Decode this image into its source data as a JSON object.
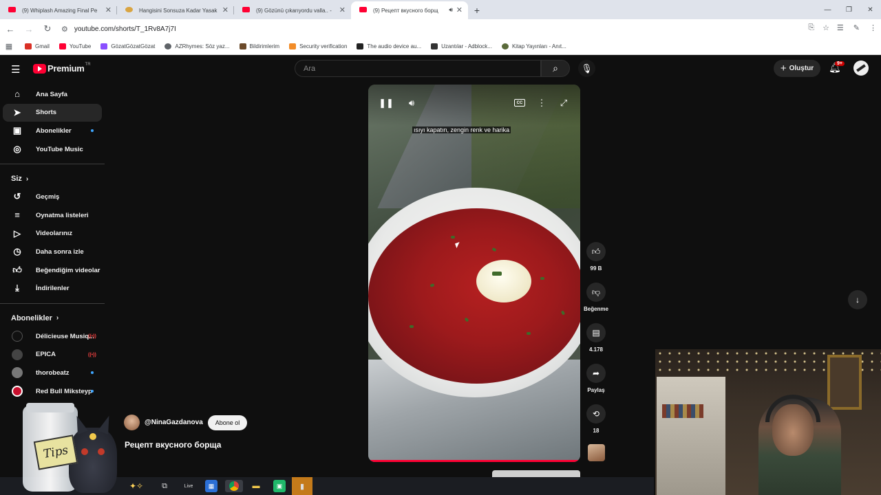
{
  "browser": {
    "tabs": [
      {
        "title": "(9) Whiplash Amazing Final Pe",
        "favicon": "youtube-icon",
        "active": false
      },
      {
        "title": "Hangisini Sonsuza Kadar Yasak",
        "favicon": "tree-icon",
        "active": false
      },
      {
        "title": "(9) Gözünü çıkarıyordu valla.. -",
        "favicon": "youtube-icon",
        "active": false
      },
      {
        "title": "(9) Рецепт вкусного борщ",
        "favicon": "youtube-icon",
        "active": true,
        "audio": true
      }
    ],
    "url": "youtube.com/shorts/T_1Rv8A7j7I",
    "bookmarks": [
      {
        "label": "Gmail",
        "color": "#d93025"
      },
      {
        "label": "YouTube",
        "color": "#ff0033"
      },
      {
        "label": "GözatGözatGözat",
        "color": "#8a4fff"
      },
      {
        "label": "AZRhymes: Söz yaz...",
        "color": "#5f6368"
      },
      {
        "label": "Bildirimlerim",
        "color": "#6b4a2a"
      },
      {
        "label": "Security verification",
        "color": "#f28c28"
      },
      {
        "label": "The audio device au...",
        "color": "#222222"
      },
      {
        "label": "Uzantılar - Adblock...",
        "color": "#333333"
      },
      {
        "label": "Kitap Yayınları - Anıt...",
        "color": "#5a6a3a"
      }
    ]
  },
  "youtube": {
    "logo_text": "Premium",
    "logo_region": "TR",
    "search_placeholder": "Ara",
    "create_label": "Oluştur",
    "notification_count": "9+",
    "accent_color": "#ff0033",
    "sidebar": {
      "main": [
        {
          "label": "Ana Sayfa",
          "icon": "home-icon"
        },
        {
          "label": "Shorts",
          "icon": "shorts-icon",
          "active": true
        },
        {
          "label": "Abonelikler",
          "icon": "subscriptions-icon",
          "dot": true
        },
        {
          "label": "YouTube Music",
          "icon": "music-icon"
        }
      ],
      "you_heading": "Siz",
      "you": [
        {
          "label": "Geçmiş",
          "icon": "history-icon"
        },
        {
          "label": "Oynatma listeleri",
          "icon": "playlists-icon"
        },
        {
          "label": "Videolarınız",
          "icon": "your-videos-icon"
        },
        {
          "label": "Daha sonra izle",
          "icon": "watch-later-icon"
        },
        {
          "label": "Beğendiğim videolar",
          "icon": "liked-icon"
        },
        {
          "label": "İndirilenler",
          "icon": "download-icon"
        }
      ],
      "subs_heading": "Abonelikler",
      "subscriptions": [
        {
          "label": "Délicieuse Musiq...",
          "indicator": "live"
        },
        {
          "label": "EPICA",
          "indicator": "live"
        },
        {
          "label": "thorobeatz",
          "indicator": "dot"
        },
        {
          "label": "Red Bull Miksteyp",
          "indicator": "dot"
        }
      ]
    },
    "short": {
      "caption": "ısıyı kapatın, zengin renk ve harika",
      "channel": "@NinaGazdanova",
      "subscribe_label": "Abone ol",
      "title": "Рецепт вкусного борща"
    },
    "actions": [
      {
        "label": "99 B",
        "icon": "like-icon"
      },
      {
        "label": "Beğenme",
        "icon": "dislike-icon"
      },
      {
        "label": "4.178",
        "icon": "comment-icon"
      },
      {
        "label": "Paylaş",
        "icon": "share-icon"
      },
      {
        "label": "18",
        "icon": "remix-icon"
      }
    ]
  },
  "overlay": {
    "tips_label": "Tips"
  }
}
